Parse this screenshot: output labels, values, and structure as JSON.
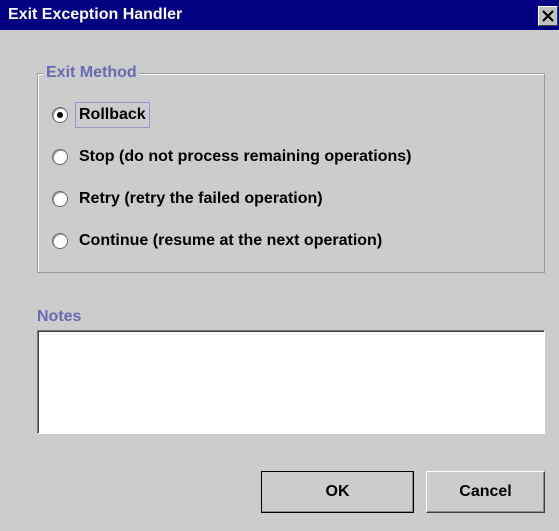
{
  "window": {
    "title": "Exit Exception Handler",
    "close_symbol": "×"
  },
  "exit_method": {
    "legend": "Exit Method",
    "selected": "Rollback",
    "options": [
      {
        "label": "Rollback",
        "checked": true
      },
      {
        "label": "Stop (do not process remaining operations)",
        "checked": false
      },
      {
        "label": "Retry (retry the failed operation)",
        "checked": false
      },
      {
        "label": "Continue (resume at the next operation)",
        "checked": false
      }
    ]
  },
  "notes": {
    "label": "Notes",
    "value": ""
  },
  "buttons": {
    "ok_label": "OK",
    "cancel_label": "Cancel"
  },
  "colors": {
    "titlebar": "#000080",
    "dialog_background": "#cccccc",
    "group_label": "#6a6ab0"
  },
  "icons": {
    "close": "close-icon",
    "radio": "radio-button-icon"
  }
}
